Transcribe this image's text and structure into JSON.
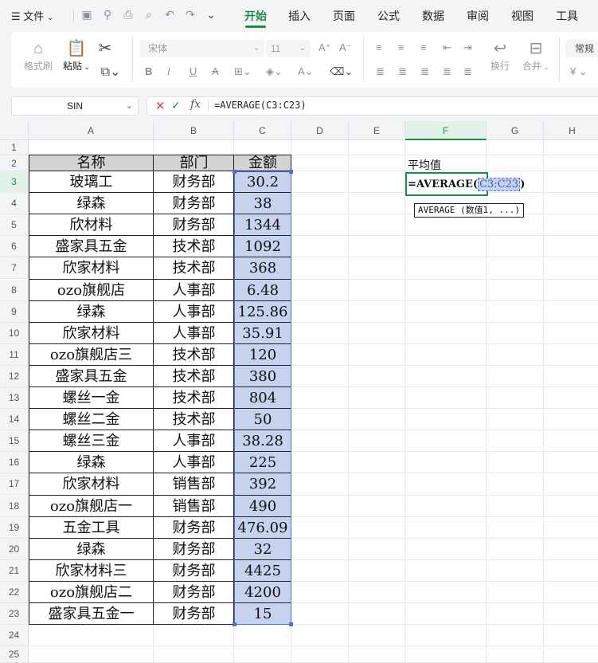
{
  "menu": {
    "file_label": "文件",
    "tabs": [
      "开始",
      "插入",
      "页面",
      "公式",
      "数据",
      "审阅",
      "视图",
      "工具"
    ],
    "active_tab": "开始"
  },
  "ribbon": {
    "format_painter": "格式刷",
    "paste": "粘贴",
    "font_name": "宋体",
    "font_size": "11",
    "wrap": "换行",
    "merge": "合并",
    "number_format": "常规",
    "currency_symbol": "¥"
  },
  "formula_bar": {
    "name_box": "SIN",
    "formula": "=AVERAGE(C3:C23)"
  },
  "columns": [
    "A",
    "B",
    "C",
    "D",
    "E",
    "F",
    "G",
    "H"
  ],
  "selected_column": "F",
  "row_numbers": [
    "1",
    "2",
    "3",
    "4",
    "5",
    "6",
    "7",
    "8",
    "9",
    "10",
    "11",
    "12",
    "13",
    "14",
    "15",
    "16",
    "17",
    "18",
    "19",
    "20",
    "21",
    "22",
    "23",
    "24",
    "25"
  ],
  "selected_row": "3",
  "table": {
    "headers": [
      "名称",
      "部门",
      "金额"
    ],
    "rows": [
      [
        "玻璃工",
        "财务部",
        "30.2"
      ],
      [
        "绿森",
        "财务部",
        "38"
      ],
      [
        "欣材料",
        "财务部",
        "1344"
      ],
      [
        "盛家具五金",
        "技术部",
        "1092"
      ],
      [
        "欣家材料",
        "技术部",
        "368"
      ],
      [
        "ozo旗舰店",
        "人事部",
        "6.48"
      ],
      [
        "绿森",
        "人事部",
        "125.86"
      ],
      [
        "欣家材料",
        "人事部",
        "35.91"
      ],
      [
        "ozo旗舰店三",
        "技术部",
        "120"
      ],
      [
        "盛家具五金",
        "技术部",
        "380"
      ],
      [
        "螺丝一金",
        "技术部",
        "804"
      ],
      [
        "螺丝二金",
        "技术部",
        "50"
      ],
      [
        "螺丝三金",
        "人事部",
        "38.28"
      ],
      [
        "绿森",
        "人事部",
        "225"
      ],
      [
        "欣家材料",
        "销售部",
        "392"
      ],
      [
        "ozo旗舰店一",
        "销售部",
        "490"
      ],
      [
        "五金工具",
        "财务部",
        "476.09"
      ],
      [
        "绿森",
        "财务部",
        "32"
      ],
      [
        "欣家材料三",
        "财务部",
        "4425"
      ],
      [
        "ozo旗舰店二",
        "财务部",
        "4200"
      ],
      [
        "盛家具五金一",
        "财务部",
        "15"
      ]
    ]
  },
  "side": {
    "label": "平均值",
    "formula_prefix": "=AVERAGE(",
    "formula_ref": "C3:C23",
    "formula_suffix": ")",
    "tooltip": "AVERAGE (数值1, ...)"
  },
  "colors": {
    "accent": "#1e8a4c",
    "selection_fill": "#c6d2ee",
    "selection_border": "#4d6fd1",
    "header_fill": "#d4d4d4"
  }
}
